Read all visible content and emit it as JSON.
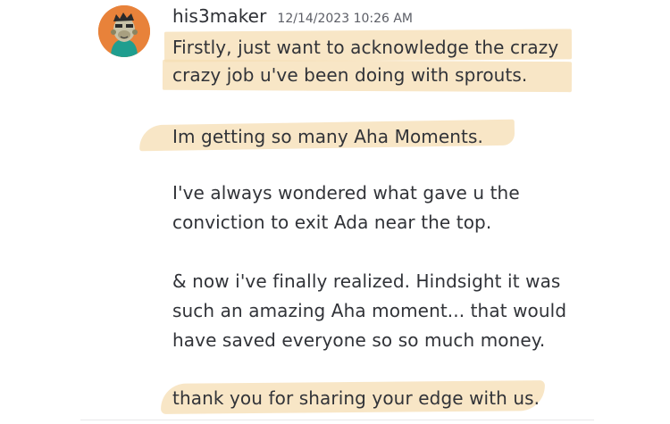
{
  "message": {
    "author": {
      "username": "his3maker",
      "avatar_icon": "ape-avatar-icon"
    },
    "timestamp": "12/14/2023 10:26 AM",
    "lines": [
      "Firstly, just want to acknowledge the crazy",
      "crazy job u've been doing with sprouts.",
      "Im getting so many Aha Moments.",
      "I've always wondered what gave u the",
      "conviction to exit Ada near the top.",
      "& now i've finally realized. Hindsight it was",
      "such an amazing Aha moment... that would",
      "have saved everyone so so much money.",
      "thank you for sharing your edge with us."
    ]
  },
  "colors": {
    "highlight": "#f5ddb3",
    "avatar_bg": "#e8823a",
    "avatar_fg": "#1f9e8f",
    "text": "#313338",
    "timestamp": "#5c5e66"
  }
}
